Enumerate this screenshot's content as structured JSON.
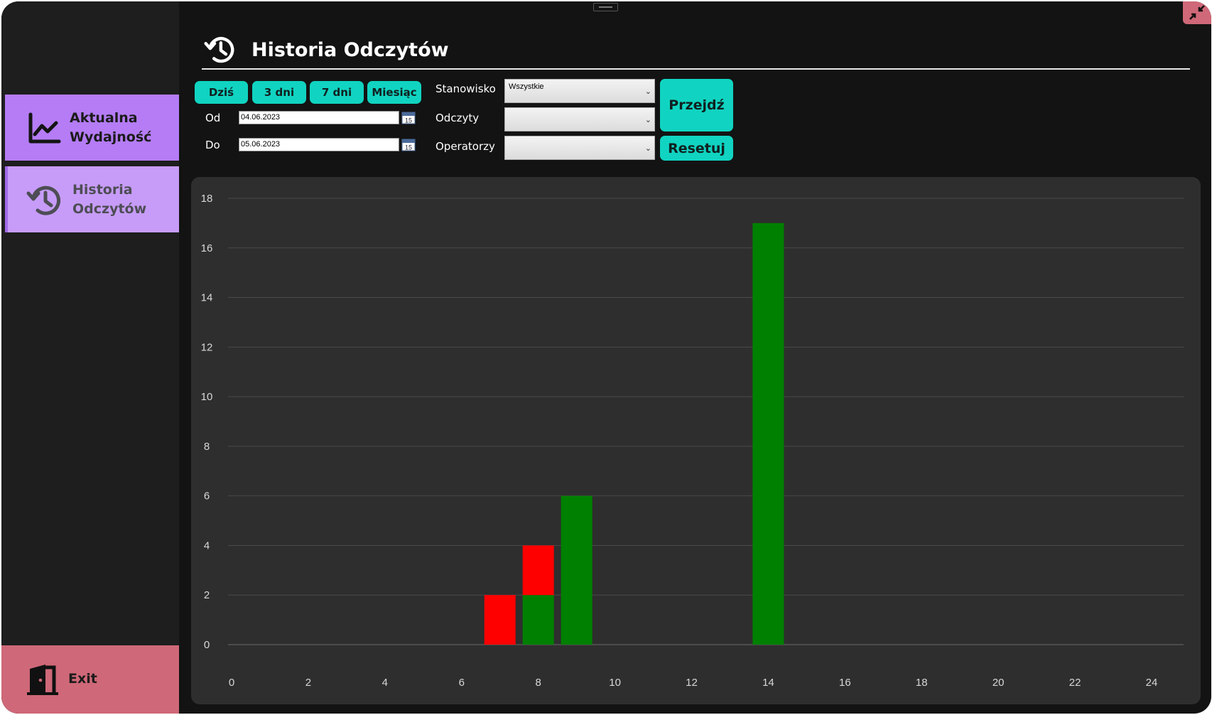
{
  "sidebar": {
    "items": [
      {
        "label": "Aktualna Wydajność",
        "icon": "chart-line-icon",
        "selected": true
      },
      {
        "label": "Historia Odczytów",
        "icon": "history-icon",
        "selected": false
      }
    ],
    "exit_label": "Exit",
    "exit_icon": "door-exit-icon"
  },
  "header": {
    "title": "Historia Odczytów",
    "icon": "history-icon"
  },
  "filters": {
    "range_buttons": [
      "Dziś",
      "3 dni",
      "7 dni",
      "Miesiąc"
    ],
    "od_label": "Od",
    "do_label": "Do",
    "od_value": "04.06.2023",
    "do_value": "05.06.2023",
    "stanowisko_label": "Stanowisko",
    "odczyty_label": "Odczyty",
    "operatorzy_label": "Operatorzy",
    "stanowisko_value": "Wszystkie",
    "odczyty_value": "",
    "operatorzy_value": "",
    "go_label": "Przejdź",
    "reset_label": "Resetuj"
  },
  "colors": {
    "accent": "#10d4c1",
    "nav_active": "#b57cf6",
    "nav_inactive": "#c79cf8",
    "exit": "#cf6878",
    "good": "#008000",
    "bad": "#ff0000"
  },
  "chart_data": {
    "type": "bar",
    "stacked": true,
    "x": [
      7,
      8,
      9,
      14
    ],
    "series": [
      {
        "color": "#008000",
        "values": [
          0,
          2,
          6,
          17
        ]
      },
      {
        "color": "#ff0000",
        "values": [
          2,
          2,
          0,
          0
        ]
      }
    ],
    "xlim": [
      0,
      24
    ],
    "ylim": [
      0,
      18
    ],
    "xticks": [
      0,
      2,
      4,
      6,
      8,
      10,
      12,
      14,
      16,
      18,
      20,
      22,
      24
    ],
    "yticks": [
      0,
      2,
      4,
      6,
      8,
      10,
      12,
      14,
      16,
      18
    ],
    "grid": true,
    "title": "",
    "xlabel": "",
    "ylabel": ""
  }
}
